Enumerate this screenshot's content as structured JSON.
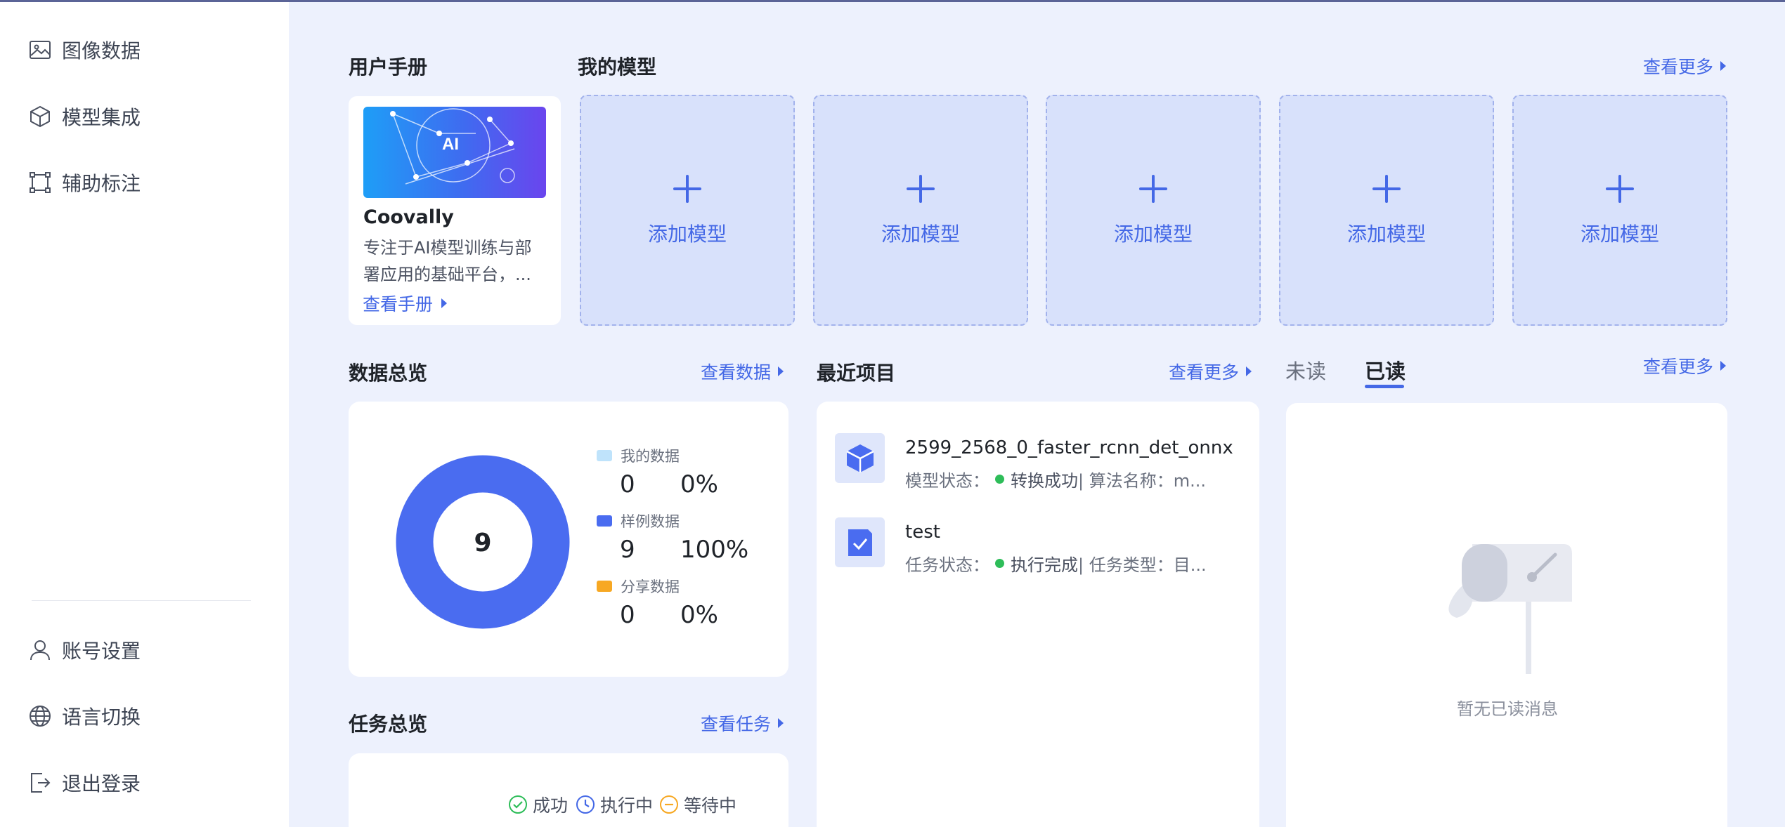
{
  "sidebar": {
    "top_items": [
      {
        "label": "图像数据",
        "icon": "image-icon"
      },
      {
        "label": "模型集成",
        "icon": "cube-icon"
      },
      {
        "label": "辅助标注",
        "icon": "annotation-icon"
      }
    ],
    "bottom_items": [
      {
        "label": "账号设置",
        "icon": "user-icon"
      },
      {
        "label": "语言切换",
        "icon": "globe-icon"
      },
      {
        "label": "退出登录",
        "icon": "logout-icon"
      }
    ]
  },
  "manual": {
    "title": "用户手册",
    "banner_text": "AI",
    "name": "Coovally",
    "desc": "专注于AI模型训练与部署应用的基础平台，...",
    "link": "查看手册"
  },
  "models": {
    "title": "我的模型",
    "more": "查看更多",
    "add_label": "添加模型"
  },
  "data_overview": {
    "title": "数据总览",
    "more": "查看数据",
    "total": "9",
    "legend": [
      {
        "name": "我的数据",
        "count": "0",
        "percent": "0%",
        "color": "#bfe3fb"
      },
      {
        "name": "样例数据",
        "count": "9",
        "percent": "100%",
        "color": "#4a6cf0"
      },
      {
        "name": "分享数据",
        "count": "0",
        "percent": "0%",
        "color": "#f7a823"
      }
    ]
  },
  "chart_data": {
    "type": "pie",
    "center_label": "9",
    "categories": [
      "我的数据",
      "样例数据",
      "分享数据"
    ],
    "values": [
      0,
      9,
      0
    ],
    "percent": [
      "0%",
      "100%",
      "0%"
    ]
  },
  "recent": {
    "title": "最近项目",
    "more": "查看更多",
    "items": [
      {
        "name": "2599_2568_0_faster_rcnn_det_onnx",
        "status_label": "模型状态：",
        "status": "转换成功",
        "extra": " | 算法名称：m..."
      },
      {
        "name": "test",
        "status_label": "任务状态：",
        "status": "执行完成",
        "extra": " | 任务类型：目..."
      }
    ]
  },
  "messages": {
    "tab_unread": "未读",
    "tab_read": "已读",
    "more": "查看更多",
    "empty": "暂无已读消息"
  },
  "tasks": {
    "title": "任务总览",
    "more": "查看任务",
    "legend": [
      "成功",
      "执行中",
      "等待中"
    ]
  },
  "colors": {
    "accent": "#4468e6",
    "success": "#2ebd59",
    "pending": "#f7a823"
  }
}
